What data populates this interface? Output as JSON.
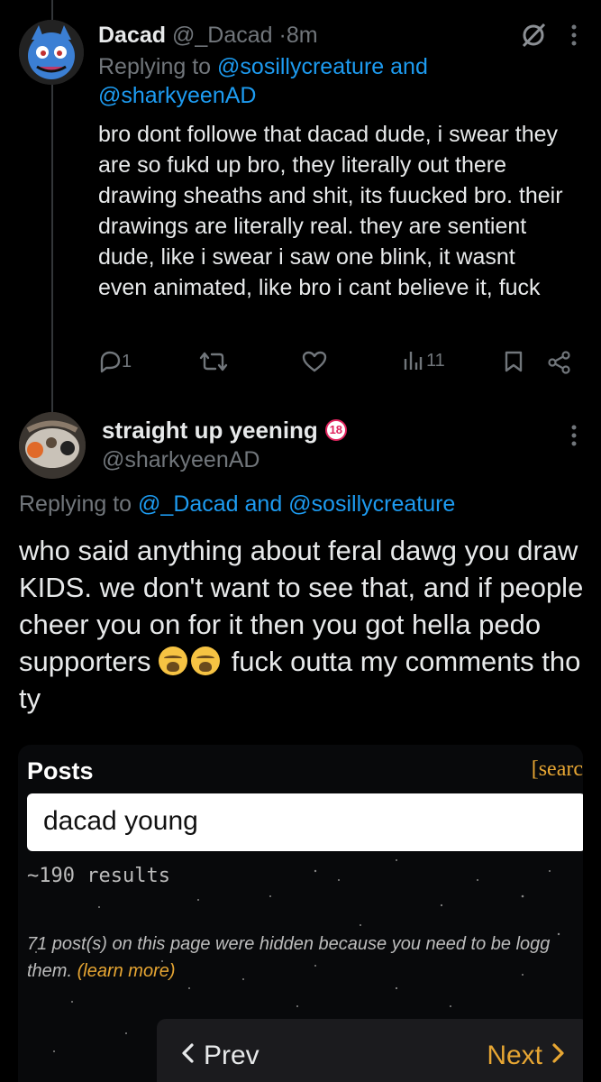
{
  "tweet1": {
    "display_name": "Dacad",
    "handle": "@_Dacad",
    "separator": "·",
    "time": "8m",
    "replying_prefix": "Replying to",
    "replying_user1": "@sosillycreature",
    "replying_and": "and",
    "replying_user2": "@sharkyeenAD",
    "body": "bro dont followe that dacad dude, i swear they are so fukd up bro, they literally out there drawing sheaths and shit, its fuucked bro. their drawings are literally real. they are sentient dude, like i swear i saw one blink, it wasnt even animated, like bro i cant believe it, fuck",
    "reply_count": "1",
    "view_count": "11"
  },
  "tweet2": {
    "display_name": "straight up yeening",
    "handle": "@sharkyeenAD",
    "replying_prefix": "Replying to",
    "replying_users": "@_Dacad and @sosillycreature",
    "body_part1": "who said anything about feral dawg you draw KIDS. we don't want to see that, and if people cheer you on for it then you got hella pedo supporters ",
    "body_part2": " fuck outta my comments tho ty"
  },
  "embed": {
    "title": "Posts",
    "search_link": "[searc",
    "search_value": "dacad young",
    "results": "~190 results",
    "hidden_note_line1": "71 post(s) on this page were hidden because you need to be logg",
    "hidden_note_line2": "them.",
    "learn_more": "(learn more)",
    "prev_label": "Prev",
    "next_label": "Next"
  },
  "colors": {
    "accent_blue": "#1d9bf0",
    "muted": "#71767b",
    "embed_accent": "#e7a633"
  }
}
